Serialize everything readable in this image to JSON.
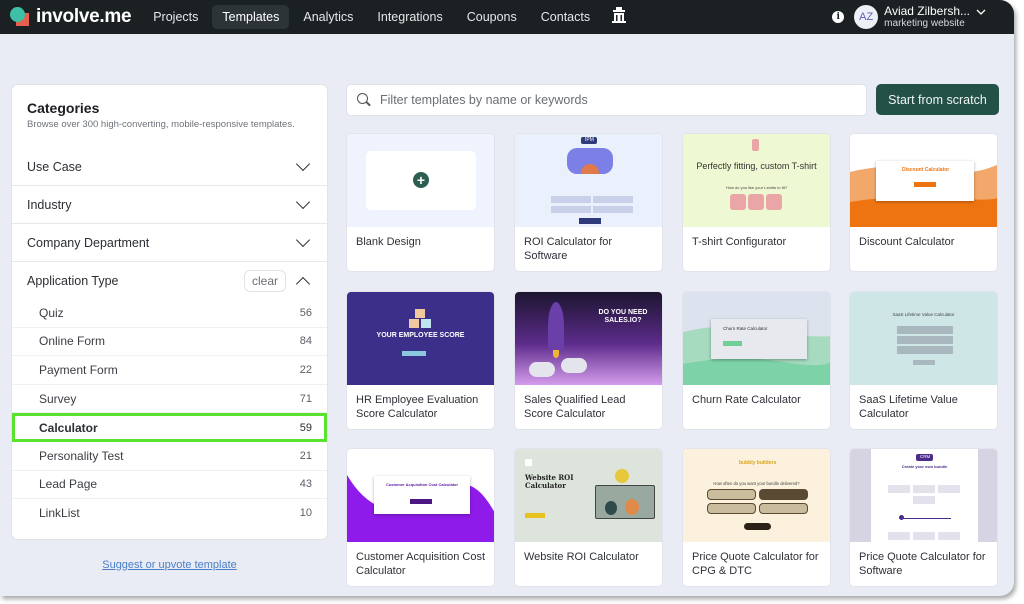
{
  "topbar": {
    "brand": "involve.me",
    "nav": [
      {
        "label": "Projects",
        "active": false
      },
      {
        "label": "Templates",
        "active": true
      },
      {
        "label": "Analytics",
        "active": false
      },
      {
        "label": "Integrations",
        "active": false
      },
      {
        "label": "Coupons",
        "active": false
      },
      {
        "label": "Contacts",
        "active": false
      }
    ],
    "extra_icon": "building-icon",
    "info_icon": "i",
    "user": {
      "initials": "AZ",
      "name": "Aviad Zilbersh...",
      "workspace": "marketing website"
    }
  },
  "sidebar": {
    "title": "Categories",
    "subtitle": "Browse over 300 high-converting, mobile-responsive templates.",
    "sections": [
      {
        "label": "Use Case",
        "expanded": false
      },
      {
        "label": "Industry",
        "expanded": false
      },
      {
        "label": "Company Department",
        "expanded": false
      },
      {
        "label": "Application Type",
        "expanded": true,
        "clear_label": "clear"
      }
    ],
    "application_types": [
      {
        "label": "Quiz",
        "count": "56",
        "selected": false
      },
      {
        "label": "Online Form",
        "count": "84",
        "selected": false
      },
      {
        "label": "Payment Form",
        "count": "22",
        "selected": false
      },
      {
        "label": "Survey",
        "count": "71",
        "selected": false
      },
      {
        "label": "Calculator",
        "count": "59",
        "selected": true
      },
      {
        "label": "Personality Test",
        "count": "21",
        "selected": false
      },
      {
        "label": "Lead Page",
        "count": "43",
        "selected": false
      },
      {
        "label": "LinkList",
        "count": "10",
        "selected": false
      }
    ],
    "suggest_link": "Suggest or upvote template"
  },
  "search": {
    "placeholder": "Filter templates by name or keywords",
    "value": ""
  },
  "start_button": "Start from scratch",
  "templates": [
    {
      "title": "Blank Design"
    },
    {
      "title": "ROI Calculator for Software",
      "thumb_text": "IPM"
    },
    {
      "title": "T-shirt Configurator",
      "thumb_text": "Perfectly fitting, custom T-shirt",
      "thumb_sub": "How do you like your t-shirts to fit?"
    },
    {
      "title": "Discount Calculator",
      "thumb_text": "Discount Calculator"
    },
    {
      "title": "HR Employee Evaluation Score Calculator",
      "thumb_text": "YOUR EMPLOYEE SCORE"
    },
    {
      "title": "Sales Qualified Lead Score Calculator",
      "thumb_text": "DO YOU NEED SALES.IO?"
    },
    {
      "title": "Churn Rate Calculator",
      "thumb_text": "Churn Rate Calculator"
    },
    {
      "title": "SaaS Lifetime Value Calculator",
      "thumb_text": "SaaS Lifetime Value Calculator"
    },
    {
      "title": "Customer Acquisition Cost Calculator",
      "thumb_text": "Customer Acquisition Cost Calculator"
    },
    {
      "title": "Website ROI Calculator",
      "thumb_text": "Website ROI Calculator"
    },
    {
      "title": "Price Quote Calculator for CPG & DTC",
      "thumb_text": "bubbly builders",
      "thumb_sub": "How often do you want your bundle delivered?"
    },
    {
      "title": "Price Quote Calculator for Software",
      "thumb_text": "CRM",
      "thumb_sub": "Create your own bundle"
    }
  ]
}
